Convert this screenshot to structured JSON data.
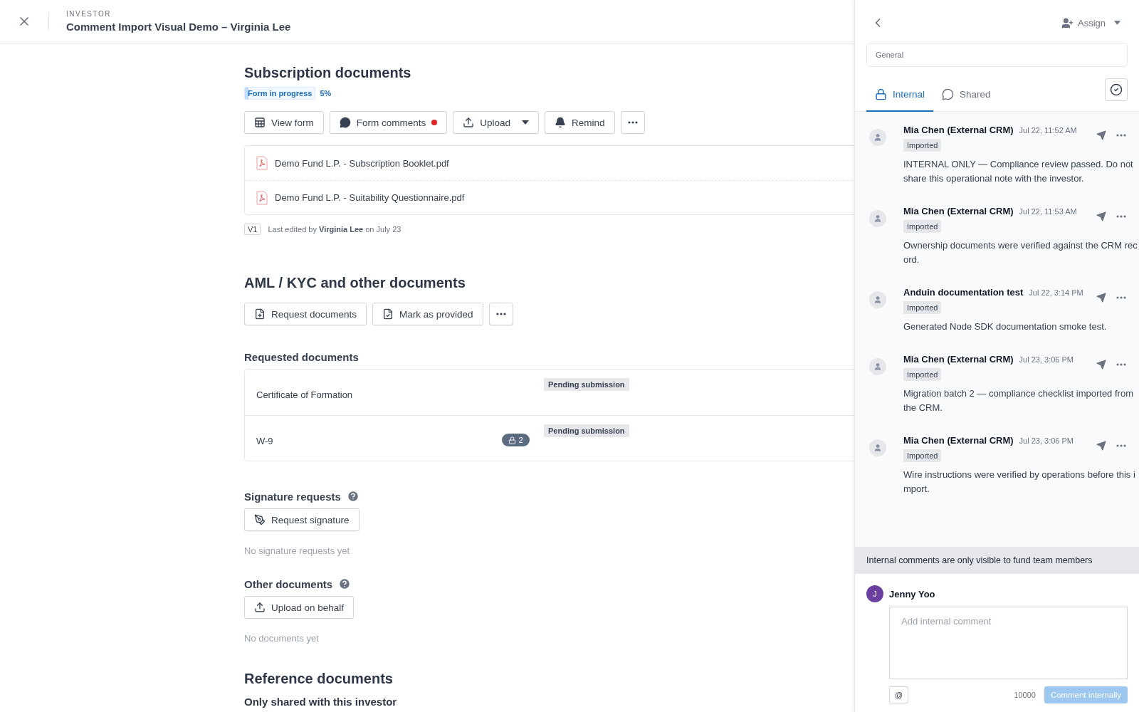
{
  "header": {
    "eyebrow": "INVESTOR",
    "title": "Comment Import Visual Demo – Virginia Lee"
  },
  "subscription": {
    "title": "Subscription documents",
    "status": {
      "label": "Form in progress",
      "level": 0.05,
      "percent": "5%"
    },
    "actions": [
      {
        "kind": "form",
        "label": "View form"
      },
      {
        "kind": "comments",
        "label": "Form comments",
        "unread": true
      },
      {
        "kind": "upload",
        "label": "Upload",
        "dropdown": true
      },
      {
        "kind": "remind",
        "label": "Remind"
      },
      {
        "kind": "more"
      }
    ],
    "files": [
      "Demo Fund L.P. - Subscription Booklet.pdf",
      "Demo Fund L.P. - Suitability Questionnaire.pdf"
    ],
    "version": {
      "tag": "V1",
      "text": "Last edited by **Virginia Lee** on July 23"
    }
  },
  "aml": {
    "title": "AML / KYC and other documents",
    "actions": [
      {
        "kind": "request",
        "label": "Request documents"
      },
      {
        "kind": "provided",
        "label": "Mark as provided"
      },
      {
        "kind": "more"
      }
    ],
    "requested_title": "Requested documents",
    "requested": [
      {
        "name": "Certificate of Formation",
        "status": "Pending submission"
      },
      {
        "name": "W-9",
        "comments": "2",
        "status": "Pending submission"
      }
    ]
  },
  "signature": {
    "title": "Signature requests",
    "button": "Request signature",
    "empty": "No signature requests yet"
  },
  "other": {
    "title": "Other documents",
    "button": "Upload on behalf",
    "empty": "No documents yet"
  },
  "reference": {
    "title": "Reference documents",
    "subtitle": "Only shared with this investor"
  },
  "panel": {
    "assign": "Assign",
    "topic": "General",
    "tabs": [
      {
        "kind": "internal",
        "label": "Internal",
        "selected": true
      },
      {
        "kind": "shared",
        "label": "Shared",
        "selected": false
      }
    ],
    "comments": [
      {
        "author": "Mia Chen (External CRM)",
        "time": "Jul 22, 11:52 AM",
        "tag": "Imported",
        "text": "INTERNAL ONLY — Compliance review passed. Do not share this operational note with the investor."
      },
      {
        "author": "Mia Chen (External CRM)",
        "time": "Jul 22, 11:53 AM",
        "tag": "Imported",
        "text": "Ownership documents were verified against the CRM record."
      },
      {
        "author": "Anduin documentation test",
        "time": "Jul 22, 3:14 PM",
        "tag": "Imported",
        "text": "Generated Node SDK documentation smoke test."
      },
      {
        "author": "Mia Chen (External CRM)",
        "time": "Jul 23, 3:06 PM",
        "tag": "Imported",
        "text": "Migration batch 2 — compliance checklist imported from the CRM."
      },
      {
        "author": "Mia Chen (External CRM)",
        "time": "Jul 23, 3:06 PM",
        "tag": "Imported",
        "text": "Wire instructions were verified by operations before this import."
      }
    ],
    "notice": "Internal comments are only visible to fund team members",
    "composer": {
      "initial": "J",
      "user": "Jenny Yoo",
      "placeholder": "Add internal comment",
      "mention": "@",
      "count": "10000",
      "submit": "Comment internally",
      "submit_disabled": true
    }
  }
}
